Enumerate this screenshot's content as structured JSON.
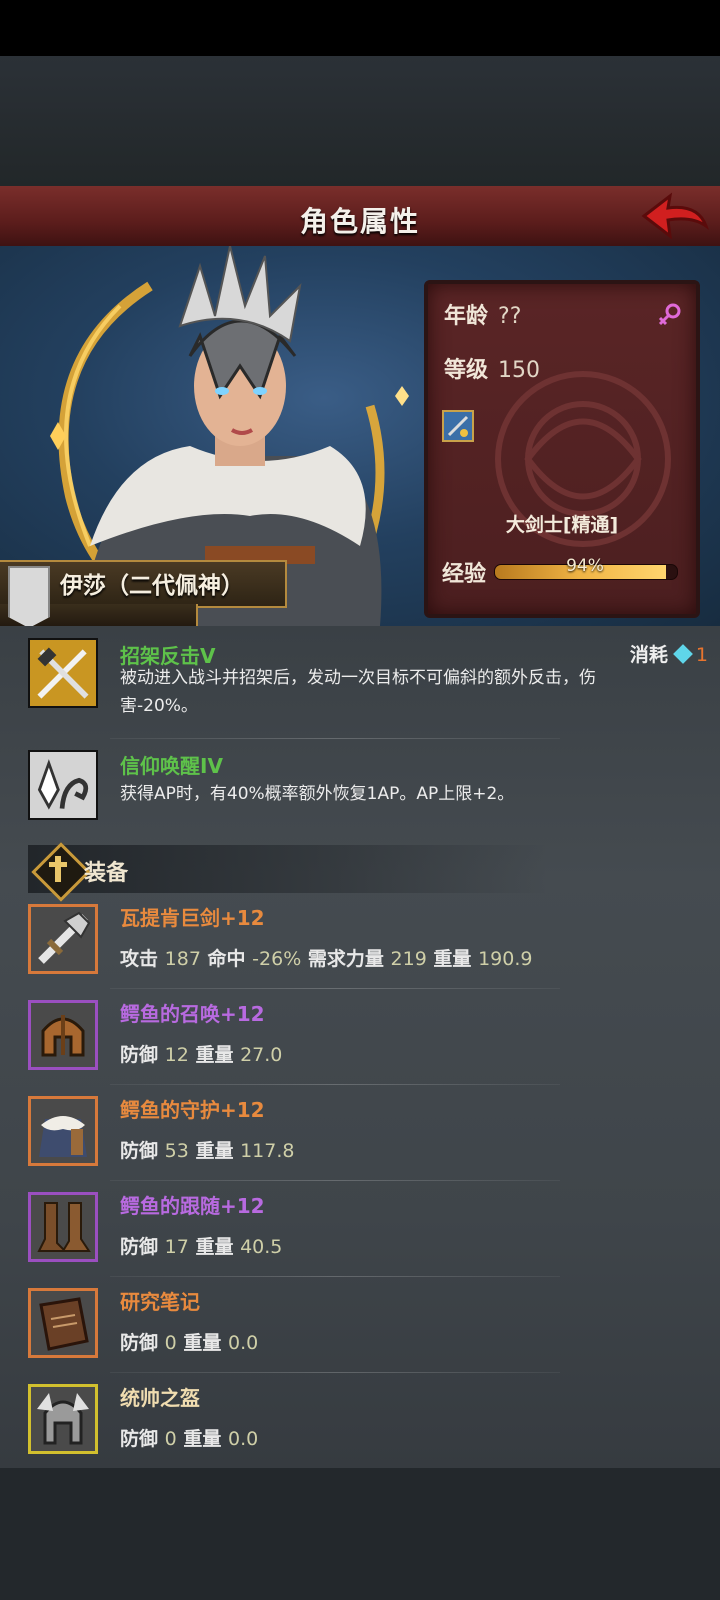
{
  "header": {
    "title": "角色属性"
  },
  "character": {
    "name": "伊莎（二代佩神）",
    "age_label": "年龄",
    "age_value": "??",
    "level_label": "等级",
    "level_value": "150",
    "class_name": "大剑士[精通]",
    "exp_label": "经验",
    "exp_percent_text": "94%",
    "exp_fraction": 0.94
  },
  "skills": [
    {
      "name": "招架反击V",
      "desc": "被动进入战斗并招架后，发动一次目标不可偏斜的额外反击，伤害-20%。",
      "icon": "parry-swords-icon"
    },
    {
      "name": "信仰唤醒IV",
      "desc": "获得AP时，有40%概率额外恢复1AP。AP上限+2。",
      "icon": "faith-hand-icon"
    }
  ],
  "cost": {
    "label": "消耗",
    "value": "1"
  },
  "equipment": {
    "header": "装备",
    "items": [
      {
        "name": "瓦提肯巨剑+12",
        "rarity": "orange",
        "icon": "greatsword-icon",
        "stats": [
          {
            "label": "攻击",
            "value": "187"
          },
          {
            "label": "命中",
            "value": "-26%"
          },
          {
            "label": "需求力量",
            "value": "219"
          },
          {
            "label": "重量",
            "value": "190.9"
          }
        ]
      },
      {
        "name": "鳄鱼的召唤+12",
        "rarity": "purple",
        "icon": "helmet-icon",
        "stats": [
          {
            "label": "防御",
            "value": "12"
          },
          {
            "label": "重量",
            "value": "27.0"
          }
        ]
      },
      {
        "name": "鳄鱼的守护+12",
        "rarity": "orange",
        "icon": "fur-armor-icon",
        "stats": [
          {
            "label": "防御",
            "value": "53"
          },
          {
            "label": "重量",
            "value": "117.8"
          }
        ]
      },
      {
        "name": "鳄鱼的跟随+12",
        "rarity": "purple",
        "icon": "boots-icon",
        "stats": [
          {
            "label": "防御",
            "value": "17"
          },
          {
            "label": "重量",
            "value": "40.5"
          }
        ]
      },
      {
        "name": "研究笔记",
        "rarity": "orange",
        "icon": "notebook-icon",
        "stats": [
          {
            "label": "防御",
            "value": "0"
          },
          {
            "label": "重量",
            "value": "0.0"
          }
        ]
      },
      {
        "name": "统帅之盔",
        "rarity": "yellow",
        "icon": "winged-helm-icon",
        "stats": [
          {
            "label": "防御",
            "value": "0"
          },
          {
            "label": "重量",
            "value": "0.0"
          }
        ]
      }
    ]
  },
  "colors": {
    "title_bar": "#6b2624",
    "stats_panel": "#52201f",
    "skill_name": "#5ec24a",
    "rarity_orange": "#e88a3e",
    "rarity_purple": "#b86ae0",
    "rarity_yellow": "#d2c02e"
  }
}
